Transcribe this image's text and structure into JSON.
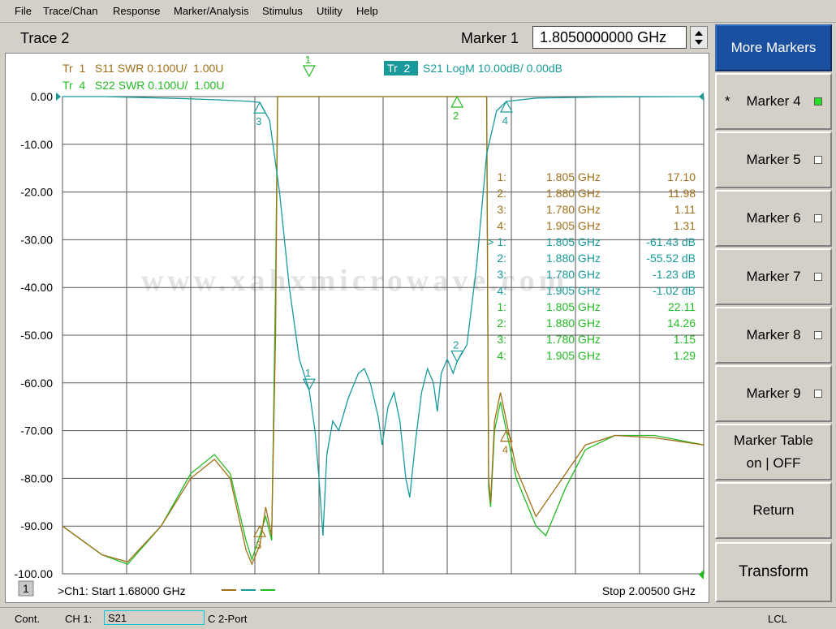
{
  "menu": [
    "File",
    "Trace/Chan",
    "Response",
    "Marker/Analysis",
    "Stimulus",
    "Utility",
    "Help"
  ],
  "header": {
    "trace_title": "Trace 2",
    "marker_label": "Marker 1",
    "marker_value": "1.8050000000 GHz"
  },
  "traces": [
    {
      "label": "Tr  1   S11 SWR 0.100U/  1.00U",
      "color": "#a07018"
    },
    {
      "label": "Tr  4   S22 SWR 0.100U/  1.00U",
      "color": "#22bb22"
    },
    {
      "active_badge": "Tr  2",
      "label": "S21 LogM 10.00dB/  0.00dB",
      "color": "#189a9a"
    }
  ],
  "y_ticks": [
    "0.00",
    "-10.00",
    "-20.00",
    "-30.00",
    "-40.00",
    "-50.00",
    "-60.00",
    "-70.00",
    "-80.00",
    "-90.00",
    "-100.00"
  ],
  "channel_number": "1",
  "start_label": ">Ch1: Start  1.68000 GHz",
  "stop_label": "Stop  2.00500 GHz",
  "watermark": "www.xahxmicrowave.com",
  "marker_table": [
    {
      "num": "1:",
      "freq": "1.805 GHz",
      "val": "17.10",
      "color": "#a07018"
    },
    {
      "num": "2:",
      "freq": "1.880 GHz",
      "val": "11.98",
      "color": "#a07018"
    },
    {
      "num": "3:",
      "freq": "1.780 GHz",
      "val": "1.11",
      "color": "#a07018"
    },
    {
      "num": "4:",
      "freq": "1.905 GHz",
      "val": "1.31",
      "color": "#a07018"
    },
    {
      "num": "> 1:",
      "freq": "1.805 GHz",
      "val": "-61.43 dB",
      "color": "#189a9a"
    },
    {
      "num": "2:",
      "freq": "1.880 GHz",
      "val": "-55.52 dB",
      "color": "#189a9a"
    },
    {
      "num": "3:",
      "freq": "1.780 GHz",
      "val": "-1.23 dB",
      "color": "#189a9a"
    },
    {
      "num": "4:",
      "freq": "1.905 GHz",
      "val": "-1.02 dB",
      "color": "#189a9a"
    },
    {
      "num": "1:",
      "freq": "1.805 GHz",
      "val": "22.11",
      "color": "#22bb22"
    },
    {
      "num": "2:",
      "freq": "1.880 GHz",
      "val": "14.26",
      "color": "#22bb22"
    },
    {
      "num": "3:",
      "freq": "1.780 GHz",
      "val": "1.15",
      "color": "#22bb22"
    },
    {
      "num": "4:",
      "freq": "1.905 GHz",
      "val": "1.29",
      "color": "#22bb22"
    }
  ],
  "softkeys": [
    {
      "label": "More Markers",
      "active": true
    },
    {
      "label": "Marker 4",
      "led": "on",
      "star": "*"
    },
    {
      "label": "Marker 5",
      "led": "off"
    },
    {
      "label": "Marker 6",
      "led": "off"
    },
    {
      "label": "Marker 7",
      "led": "off"
    },
    {
      "label": "Marker 8",
      "led": "off"
    },
    {
      "label": "Marker 9",
      "led": "off"
    },
    {
      "label": "Marker Table\non | OFF"
    },
    {
      "label": "Return"
    },
    {
      "label": "Transform"
    }
  ],
  "status": {
    "mode": "Cont.",
    "channel": "CH 1:",
    "param": "S21",
    "cal": "C  2-Port",
    "ref": "LCL"
  },
  "chart_data": {
    "type": "line",
    "x_range_ghz": [
      1.68,
      2.005
    ],
    "y_range_db": [
      -100,
      0
    ],
    "x_divisions": 10,
    "y_divisions": 10,
    "series": [
      {
        "name": "S21",
        "color": "#189a9a",
        "points": [
          [
            1.68,
            0
          ],
          [
            1.7,
            0
          ],
          [
            1.72,
            -0.2
          ],
          [
            1.74,
            -0.4
          ],
          [
            1.76,
            -0.7
          ],
          [
            1.775,
            -1.0
          ],
          [
            1.78,
            -1.23
          ],
          [
            1.785,
            -5
          ],
          [
            1.79,
            -20
          ],
          [
            1.795,
            -40
          ],
          [
            1.8,
            -55
          ],
          [
            1.805,
            -61.43
          ],
          [
            1.808,
            -70
          ],
          [
            1.81,
            -80
          ],
          [
            1.812,
            -92
          ],
          [
            1.814,
            -75
          ],
          [
            1.817,
            -68
          ],
          [
            1.82,
            -70
          ],
          [
            1.825,
            -63
          ],
          [
            1.83,
            -58
          ],
          [
            1.833,
            -57
          ],
          [
            1.836,
            -60
          ],
          [
            1.84,
            -67
          ],
          [
            1.842,
            -73
          ],
          [
            1.845,
            -65
          ],
          [
            1.848,
            -62
          ],
          [
            1.851,
            -68
          ],
          [
            1.854,
            -80
          ],
          [
            1.856,
            -84
          ],
          [
            1.859,
            -72
          ],
          [
            1.862,
            -62
          ],
          [
            1.865,
            -57
          ],
          [
            1.868,
            -60
          ],
          [
            1.87,
            -66
          ],
          [
            1.872,
            -58
          ],
          [
            1.875,
            -55
          ],
          [
            1.878,
            -58
          ],
          [
            1.88,
            -55.52
          ],
          [
            1.885,
            -52
          ],
          [
            1.89,
            -35
          ],
          [
            1.895,
            -12
          ],
          [
            1.9,
            -3
          ],
          [
            1.905,
            -1.02
          ],
          [
            1.92,
            -0.3
          ],
          [
            1.95,
            -0.1
          ],
          [
            2.005,
            0
          ]
        ]
      },
      {
        "name": "S11",
        "color": "#a07018",
        "points": [
          [
            1.68,
            -90
          ],
          [
            1.7,
            -96
          ],
          [
            1.713,
            -97.5
          ],
          [
            1.73,
            -90
          ],
          [
            1.745,
            -80
          ],
          [
            1.757,
            -76
          ],
          [
            1.765,
            -80
          ],
          [
            1.773,
            -95
          ],
          [
            1.776,
            -98
          ],
          [
            1.78,
            -94
          ],
          [
            1.783,
            -86
          ],
          [
            1.786,
            -92
          ],
          [
            1.788,
            -50
          ],
          [
            1.789,
            0
          ],
          [
            1.895,
            0
          ],
          [
            1.896,
            -80
          ],
          [
            1.897,
            -85
          ],
          [
            1.899,
            -68
          ],
          [
            1.902,
            -62
          ],
          [
            1.905,
            -68
          ],
          [
            1.91,
            -78
          ],
          [
            1.92,
            -88
          ],
          [
            1.93,
            -82
          ],
          [
            1.945,
            -73
          ],
          [
            1.96,
            -71
          ],
          [
            1.98,
            -71.5
          ],
          [
            2.005,
            -73
          ]
        ]
      },
      {
        "name": "S22",
        "color": "#22bb22",
        "points": [
          [
            1.68,
            -90
          ],
          [
            1.7,
            -96
          ],
          [
            1.713,
            -98
          ],
          [
            1.73,
            -90
          ],
          [
            1.745,
            -79
          ],
          [
            1.757,
            -75
          ],
          [
            1.765,
            -79
          ],
          [
            1.773,
            -93
          ],
          [
            1.776,
            -97
          ],
          [
            1.78,
            -92
          ],
          [
            1.783,
            -88
          ],
          [
            1.786,
            -93
          ],
          [
            1.788,
            -40
          ],
          [
            1.789,
            0
          ],
          [
            1.895,
            0
          ],
          [
            1.896,
            -82
          ],
          [
            1.897,
            -86
          ],
          [
            1.899,
            -70
          ],
          [
            1.902,
            -64
          ],
          [
            1.905,
            -70
          ],
          [
            1.91,
            -80
          ],
          [
            1.92,
            -90
          ],
          [
            1.925,
            -92
          ],
          [
            1.935,
            -82
          ],
          [
            1.945,
            -74
          ],
          [
            1.96,
            -71
          ],
          [
            1.98,
            -71
          ],
          [
            2.005,
            -73
          ]
        ]
      }
    ],
    "markers": [
      {
        "id": "1",
        "trace": "S21",
        "x": 1.805,
        "y": -61.43,
        "side": "down"
      },
      {
        "id": "2",
        "trace": "S21",
        "x": 1.88,
        "y": -55.52,
        "side": "down"
      },
      {
        "id": "3",
        "trace": "S21",
        "x": 1.78,
        "y": -1.23,
        "side": "up"
      },
      {
        "id": "4",
        "trace": "S21",
        "x": 1.905,
        "y": -1.02,
        "side": "up"
      },
      {
        "id": "1",
        "trace": "S22",
        "x": 1.805,
        "y": 0,
        "side": "down",
        "top": true
      },
      {
        "id": "2",
        "trace": "S22",
        "x": 1.88,
        "y": 0,
        "side": "up"
      },
      {
        "id": "3",
        "trace": "S11",
        "x": 1.78,
        "y": -90,
        "side": "up"
      },
      {
        "id": "4",
        "trace": "S11",
        "x": 1.905,
        "y": -70,
        "side": "up"
      }
    ]
  }
}
